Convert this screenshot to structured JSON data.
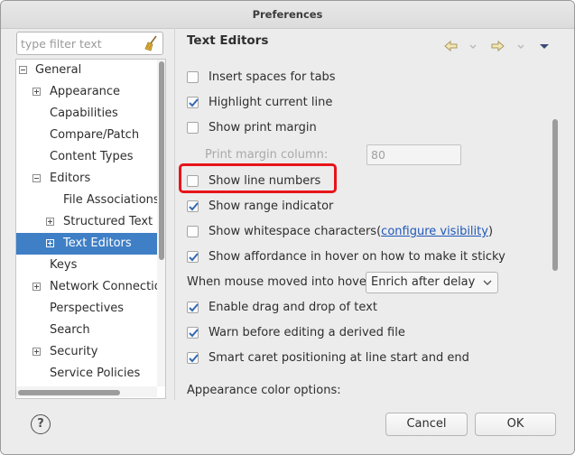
{
  "window": {
    "title": "Preferences"
  },
  "filter": {
    "placeholder": "type filter text",
    "icon": "clear-filter-broom-icon"
  },
  "tree": {
    "items": [
      {
        "label": "General",
        "expander": "minus"
      },
      {
        "label": "Appearance",
        "expander": "plus"
      },
      {
        "label": "Capabilities",
        "expander": "none"
      },
      {
        "label": "Compare/Patch",
        "expander": "none"
      },
      {
        "label": "Content Types",
        "expander": "none"
      },
      {
        "label": "Editors",
        "expander": "minus"
      },
      {
        "label": "File Associations",
        "expander": "none"
      },
      {
        "label": "Structured Text E",
        "expander": "plus"
      },
      {
        "label": "Text Editors",
        "expander": "plus",
        "selected": true
      },
      {
        "label": "Keys",
        "expander": "none"
      },
      {
        "label": "Network Connection",
        "expander": "plus"
      },
      {
        "label": "Perspectives",
        "expander": "none"
      },
      {
        "label": "Search",
        "expander": "none"
      },
      {
        "label": "Security",
        "expander": "plus"
      },
      {
        "label": "Service Policies",
        "expander": "none"
      }
    ]
  },
  "page": {
    "title": "Text Editors",
    "nav_icons": [
      "back-arrow-icon",
      "back-dropdown-icon",
      "forward-arrow-icon",
      "forward-dropdown-icon",
      "view-menu-icon"
    ],
    "options": {
      "insert_spaces": {
        "label": "Insert spaces for tabs",
        "checked": false
      },
      "highlight_line": {
        "label": "Highlight current line",
        "checked": true
      },
      "print_margin": {
        "label": "Show print margin",
        "checked": false
      },
      "print_margin_column": {
        "label": "Print margin column:",
        "value": "80"
      },
      "line_numbers": {
        "label": "Show line numbers",
        "checked": false
      },
      "range_indicator": {
        "label": "Show range indicator",
        "checked": true
      },
      "whitespace": {
        "label": "Show whitespace characters",
        "link": "configure visibility",
        "open_paren": "(",
        "close_paren": ")",
        "checked": false
      },
      "affordance": {
        "label": "Show affordance in hover on how to make it sticky",
        "checked": true
      },
      "hover_behavior": {
        "label": "When mouse moved into hover:",
        "value": "Enrich after delay"
      },
      "drag_drop": {
        "label": "Enable drag and drop of text",
        "checked": true
      },
      "warn_derived": {
        "label": "Warn before editing a derived file",
        "checked": true
      },
      "smart_caret": {
        "label": "Smart caret positioning at line start and end",
        "checked": true
      },
      "appearance_colors": {
        "label": "Appearance color options:"
      }
    }
  },
  "buttons": {
    "cancel": "Cancel",
    "ok": "OK",
    "help": "?"
  },
  "colors": {
    "selection": "#3f7fc6",
    "highlight_box": "#e8141a",
    "link": "#1f58b8"
  }
}
